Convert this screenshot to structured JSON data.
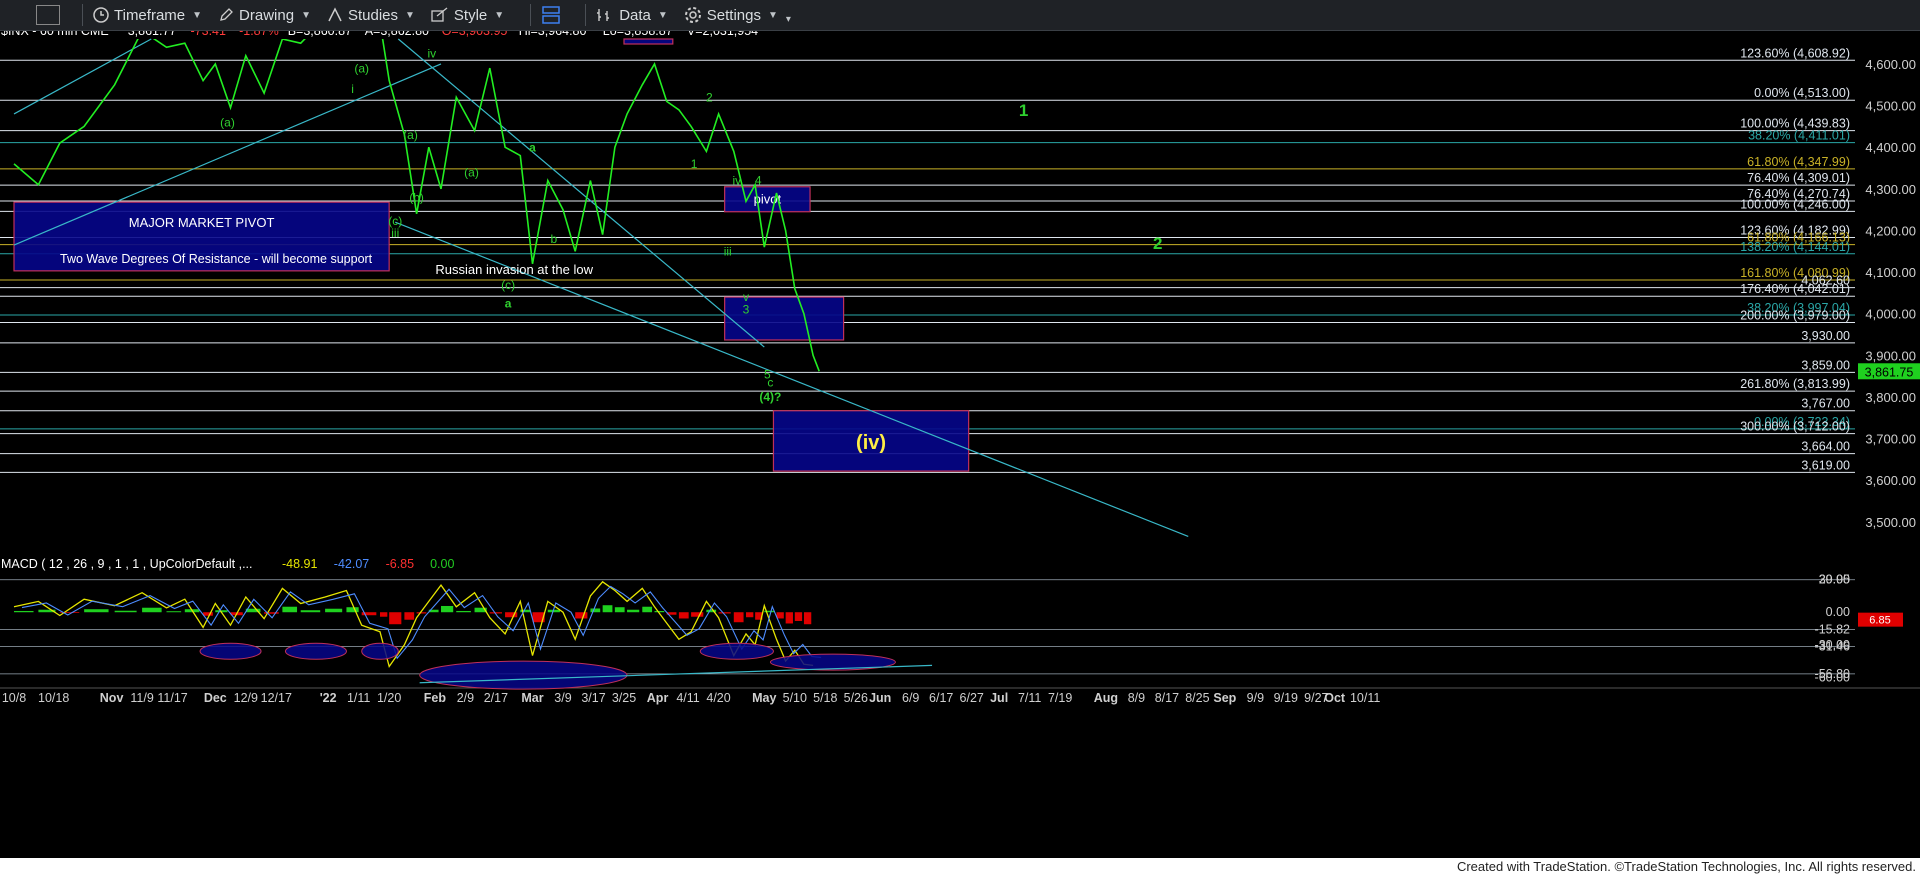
{
  "toolbar": {
    "items": [
      {
        "label": "Timeframe",
        "icon": "clock-icon"
      },
      {
        "label": "Drawing",
        "icon": "pencil-icon"
      },
      {
        "label": "Studies",
        "icon": "studies-icon"
      },
      {
        "label": "Style",
        "icon": "style-icon"
      },
      {
        "label": "Data",
        "icon": "bar-data-icon"
      },
      {
        "label": "Settings",
        "icon": "gear-icon"
      }
    ]
  },
  "footer": {
    "text": "Created with TradeStation. ©TradeStation Technologies, Inc. All rights reserved."
  },
  "chart_data": {
    "type": "line",
    "header": {
      "symbol": "$INX - 60 min CME",
      "last": "3,861.77",
      "change": "-73.41",
      "change_pct": "-1.87%",
      "bid": "B=3,860.87",
      "ask": "A=3,862.80",
      "open": "O=3,903.95",
      "high": "Hi=3,964.80",
      "low": "Lo=3,858.87",
      "volume": "V=2,031,954"
    },
    "ylim": [
      3430,
      4660
    ],
    "y_ticks": [
      "4,600.00",
      "4,500.00",
      "4,400.00",
      "4,300.00",
      "4,200.00",
      "4,100.00",
      "4,000.00",
      "3,900.00",
      "3,800.00",
      "3,700.00",
      "3,600.00",
      "3,500.00"
    ],
    "y_tick_values": [
      4600,
      4500,
      4400,
      4300,
      4200,
      4100,
      4000,
      3900,
      3800,
      3700,
      3600,
      3500
    ],
    "x_ticks": [
      "10/8",
      "10/18",
      "Nov",
      "11/9",
      "11/17",
      "Dec",
      "12/9",
      "12/17",
      "'22",
      "1/11",
      "1/20",
      "Feb",
      "2/9",
      "2/17",
      "Mar",
      "3/9",
      "3/17",
      "3/25",
      "Apr",
      "4/11",
      "4/20",
      "May",
      "5/10",
      "5/18",
      "5/26",
      "Jun",
      "6/9",
      "6/17",
      "6/27",
      "Jul",
      "7/11",
      "7/19",
      "Aug",
      "8/9",
      "8/17",
      "8/25",
      "Sep",
      "9/9",
      "9/19",
      "9/27",
      "Oct",
      "10/11"
    ],
    "x_tick_index": [
      0,
      1.3,
      3.2,
      4.2,
      5.2,
      6.6,
      7.6,
      8.6,
      10.3,
      11.3,
      12.3,
      13.8,
      14.8,
      15.8,
      17,
      18,
      19,
      20,
      21.1,
      22.1,
      23.1,
      24.6,
      25.6,
      26.6,
      27.6,
      28.4,
      29.4,
      30.4,
      31.4,
      32.3,
      33.3,
      34.3,
      35.8,
      36.8,
      37.8,
      38.8,
      39.7,
      40.7,
      41.7,
      42.7,
      43.3,
      44.3
    ],
    "last_price": "3,861.75",
    "last_value": 3861.75,
    "price_path": [
      [
        0,
        4360
      ],
      [
        0.8,
        4310
      ],
      [
        1.5,
        4410
      ],
      [
        2.3,
        4450
      ],
      [
        3.3,
        4550
      ],
      [
        4.2,
        4680
      ],
      [
        5,
        4640
      ],
      [
        5.6,
        4650
      ],
      [
        6.2,
        4560
      ],
      [
        6.6,
        4600
      ],
      [
        7.1,
        4495
      ],
      [
        7.6,
        4620
      ],
      [
        8.2,
        4530
      ],
      [
        8.8,
        4660
      ],
      [
        9.4,
        4650
      ],
      [
        10.2,
        4710
      ],
      [
        10.9,
        4800
      ],
      [
        11.4,
        4700
      ],
      [
        12,
        4700
      ],
      [
        12.3,
        4560
      ],
      [
        12.8,
        4430
      ],
      [
        13.2,
        4240
      ],
      [
        13.6,
        4400
      ],
      [
        14,
        4300
      ],
      [
        14.5,
        4520
      ],
      [
        15.1,
        4440
      ],
      [
        15.6,
        4590
      ],
      [
        16.1,
        4400
      ],
      [
        16.6,
        4380
      ],
      [
        17,
        4120
      ],
      [
        17.5,
        4320
      ],
      [
        18,
        4250
      ],
      [
        18.4,
        4150
      ],
      [
        18.9,
        4320
      ],
      [
        19.3,
        4190
      ],
      [
        19.7,
        4400
      ],
      [
        20.1,
        4480
      ],
      [
        20.6,
        4550
      ],
      [
        21,
        4600
      ],
      [
        21.4,
        4510
      ],
      [
        21.8,
        4490
      ],
      [
        22.2,
        4450
      ],
      [
        22.7,
        4390
      ],
      [
        23.1,
        4480
      ],
      [
        23.6,
        4390
      ],
      [
        24,
        4270
      ],
      [
        24.3,
        4310
      ],
      [
        24.6,
        4160
      ],
      [
        25,
        4290
      ],
      [
        25.3,
        4200
      ],
      [
        25.6,
        4060
      ],
      [
        25.9,
        4000
      ],
      [
        26.2,
        3900
      ],
      [
        26.4,
        3862
      ]
    ],
    "price_series_color": "#22ee22",
    "levels": [
      {
        "label": "123.60% (4,608.92)",
        "value": 4608.92,
        "color": "#dfe6ee"
      },
      {
        "label": "0.00% (4,513.00)",
        "value": 4513.0,
        "color": "#dfe6ee"
      },
      {
        "label": "100.00% (4,439.83)",
        "value": 4439.83,
        "color": "#dfe6ee"
      },
      {
        "label": "38.20% (4,411.01)",
        "value": 4411.01,
        "color": "#2aa7a7"
      },
      {
        "label": "61.80% (4,347.99)",
        "value": 4347.99,
        "color": "#c9b227"
      },
      {
        "label": "76.40% (4,309.01)",
        "value": 4309.01,
        "color": "#dfe6ee"
      },
      {
        "label": "76.40% (4,270.74)",
        "value": 4270.74,
        "color": "#dfe6ee"
      },
      {
        "label": "100.00% (4,246.00)",
        "value": 4246.0,
        "color": "#dfe6ee"
      },
      {
        "label": "123.60% (4,182.99)",
        "value": 4182.99,
        "color": "#dfe6ee"
      },
      {
        "label": "61.80% (4,166.13)",
        "value": 4166.13,
        "color": "#c9b227"
      },
      {
        "label": "138.20% (4,144.01)",
        "value": 4144.01,
        "color": "#2aa7a7"
      },
      {
        "label": "161.80% (4,080.99)",
        "value": 4080.99,
        "color": "#c9b227"
      },
      {
        "label": "4,062.60",
        "value": 4062.6,
        "color": "#dfe6ee"
      },
      {
        "label": "176.40% (4,042.01)",
        "value": 4042.01,
        "color": "#dfe6ee"
      },
      {
        "label": "38.20% (3,997.04)",
        "value": 3997.04,
        "color": "#2aa7a7"
      },
      {
        "label": "200.00% (3,979.00)",
        "value": 3979.0,
        "color": "#dfe6ee"
      },
      {
        "label": "3,930.00",
        "value": 3930.0,
        "color": "#dfe6ee"
      },
      {
        "label": "3,859.00",
        "value": 3859.0,
        "color": "#dfe6ee"
      },
      {
        "label": "261.80% (3,813.99)",
        "value": 3813.99,
        "color": "#dfe6ee"
      },
      {
        "label": "3,767.00",
        "value": 3767.0,
        "color": "#dfe6ee"
      },
      {
        "label": "0.00% (3,723.34)",
        "value": 3723.34,
        "color": "#2aa7a7"
      },
      {
        "label": "300.00% (3,712.00)",
        "value": 3712.0,
        "color": "#dfe6ee"
      },
      {
        "label": "3,664.00",
        "value": 3664.0,
        "color": "#dfe6ee"
      },
      {
        "label": "3,619.00",
        "value": 3619.0,
        "color": "#dfe6ee"
      }
    ],
    "zones": [
      {
        "label": "MAJOR MARKET PIVOT",
        "label2": "Two Wave Degrees Of Resistance - will become support",
        "x0": 0,
        "x1": 12.3,
        "y0": 4268,
        "y1": 4103
      },
      {
        "label": "pivot",
        "x0": 23.3,
        "x1": 26.1,
        "y0": 4305,
        "y1": 4245
      },
      {
        "label": "",
        "x0": 23.3,
        "x1": 27.2,
        "y0": 4040,
        "y1": 3937
      },
      {
        "label": "(iv)",
        "x0": 24.9,
        "x1": 31.3,
        "y0": 3767,
        "y1": 3622
      },
      {
        "label": "",
        "x0": 20,
        "x1": 21.6,
        "y0": 4660,
        "y1": 4648
      }
    ],
    "trendlines": [
      {
        "x0": 0,
        "y0": 4165,
        "x1": 14,
        "y1": 4600,
        "color": "#39b8c8"
      },
      {
        "x0": 0,
        "y0": 4480,
        "x1": 4.5,
        "y1": 4660,
        "color": "#39b8c8"
      },
      {
        "x0": 12.5,
        "y0": 4220,
        "x1": 38.5,
        "y1": 3465,
        "color": "#39b8c8"
      },
      {
        "x0": 12.6,
        "y0": 4660,
        "x1": 24.6,
        "y1": 3920,
        "color": "#39b8c8"
      }
    ],
    "annotations": [
      {
        "text": "(a)",
        "x": 7,
        "y": 4450,
        "color": "#2fd02f"
      },
      {
        "text": "iv",
        "x": 13.7,
        "y": 4615,
        "color": "#2fd02f"
      },
      {
        "text": "(a)",
        "x": 11.4,
        "y": 4580,
        "color": "#2fd02f"
      },
      {
        "text": "i",
        "x": 11.1,
        "y": 4530,
        "color": "#2fd02f"
      },
      {
        "text": "iii",
        "x": 12.5,
        "y": 4184,
        "color": "#2fd02f"
      },
      {
        "text": "(c)",
        "x": 12.5,
        "y": 4213,
        "color": "#2fd02f"
      },
      {
        "text": "(a)",
        "x": 13,
        "y": 4420,
        "color": "#2fd02f"
      },
      {
        "text": "(b)",
        "x": 13.2,
        "y": 4270,
        "color": "#2fd02f"
      },
      {
        "text": "(a)",
        "x": 15,
        "y": 4330,
        "color": "#2fd02f"
      },
      {
        "text": "a",
        "x": 17,
        "y": 4390,
        "color": "#2fd02f"
      },
      {
        "text": "b",
        "x": 17.7,
        "y": 4170,
        "color": "#2fd02f"
      },
      {
        "text": "(c)",
        "x": 16.2,
        "y": 4060,
        "color": "#2fd02f"
      },
      {
        "text": "a",
        "x": 16.2,
        "y": 4015,
        "color": "#2fd02f"
      },
      {
        "text": "2",
        "x": 22.8,
        "y": 4510,
        "color": "#2fd02f"
      },
      {
        "text": "1",
        "x": 22.3,
        "y": 4350,
        "color": "#2fd02f"
      },
      {
        "text": "iv",
        "x": 23.7,
        "y": 4310,
        "color": "#2fd02f"
      },
      {
        "text": "4",
        "x": 24.4,
        "y": 4310,
        "color": "#2fd02f"
      },
      {
        "text": "iii",
        "x": 23.4,
        "y": 4140,
        "color": "#2fd02f"
      },
      {
        "text": "v",
        "x": 24,
        "y": 4030,
        "color": "#2fd02f"
      },
      {
        "text": "3",
        "x": 24,
        "y": 4000,
        "color": "#2fd02f"
      },
      {
        "text": "5",
        "x": 24.7,
        "y": 3845,
        "color": "#2fd02f"
      },
      {
        "text": "c",
        "x": 24.8,
        "y": 3825,
        "color": "#2fd02f"
      },
      {
        "text": "(4)?",
        "x": 24.8,
        "y": 3790,
        "color": "#2fd02f"
      },
      {
        "text": "1",
        "x": 33.1,
        "y": 4475,
        "color": "#2fd02f"
      },
      {
        "text": "2",
        "x": 37.5,
        "y": 4155,
        "color": "#2fd02f"
      },
      {
        "text": "Russian invasion at the low",
        "x": 16.4,
        "y": 4095,
        "color": "#ffffff"
      }
    ],
    "macd": {
      "label": "MACD ( 12 , 26 , 9 , 1 , 1 , UpColorDefault ,...",
      "values": [
        "-48.91",
        "-42.07",
        "-6.85",
        "0.00"
      ],
      "value_colors": [
        "#e6e600",
        "#4d8cff",
        "#ff3030",
        "#22cc22"
      ],
      "ylim": [
        -68,
        38
      ],
      "y_ticks": [
        "29.95",
        "30.00",
        "0.00",
        "-15.82",
        "-31.46",
        "-30.00",
        "-56.80",
        "-60.00"
      ],
      "y_tick_values": [
        29.95,
        30,
        0,
        -15.82,
        -31.46,
        -30,
        -56.8,
        -60
      ],
      "last_hist": "6.85",
      "hline_values": [
        29.95,
        -15.82,
        -31.46,
        -56.8
      ],
      "macd_path": [
        [
          0,
          5
        ],
        [
          0.8,
          10
        ],
        [
          1.5,
          -3
        ],
        [
          2.3,
          12
        ],
        [
          3.3,
          6
        ],
        [
          4.2,
          18
        ],
        [
          5,
          4
        ],
        [
          5.6,
          12
        ],
        [
          6.2,
          -14
        ],
        [
          6.6,
          8
        ],
        [
          7.1,
          -12
        ],
        [
          7.6,
          14
        ],
        [
          8.2,
          -6
        ],
        [
          8.8,
          22
        ],
        [
          9.4,
          8
        ],
        [
          10.2,
          14
        ],
        [
          10.9,
          20
        ],
        [
          11.4,
          -12
        ],
        [
          12,
          -18
        ],
        [
          12.3,
          -50
        ],
        [
          12.8,
          -30
        ],
        [
          13.2,
          -5
        ],
        [
          13.6,
          10
        ],
        [
          14,
          25
        ],
        [
          14.5,
          5
        ],
        [
          15.1,
          18
        ],
        [
          15.6,
          -5
        ],
        [
          16.1,
          -20
        ],
        [
          16.6,
          10
        ],
        [
          17,
          -40
        ],
        [
          17.5,
          10
        ],
        [
          18,
          0
        ],
        [
          18.4,
          -25
        ],
        [
          18.9,
          15
        ],
        [
          19.3,
          28
        ],
        [
          19.7,
          20
        ],
        [
          20.1,
          10
        ],
        [
          20.6,
          22
        ],
        [
          21,
          5
        ],
        [
          21.4,
          -10
        ],
        [
          21.8,
          -25
        ],
        [
          22.2,
          -18
        ],
        [
          22.7,
          10
        ],
        [
          23.1,
          -5
        ],
        [
          23.6,
          -40
        ],
        [
          24,
          -20
        ],
        [
          24.3,
          -30
        ],
        [
          24.6,
          6
        ],
        [
          25,
          -25
        ],
        [
          25.3,
          -45
        ],
        [
          25.6,
          -35
        ],
        [
          25.9,
          -48
        ],
        [
          26.2,
          -49
        ]
      ],
      "ellipses": [
        {
          "x0": 6.1,
          "x1": 8.1,
          "yc": -36
        },
        {
          "x0": 8.9,
          "x1": 10.9,
          "yc": -36
        },
        {
          "x0": 11.4,
          "x1": 12.6,
          "yc": -36
        },
        {
          "x0": 13.3,
          "x1": 20.1,
          "yc": -58
        },
        {
          "x0": 22.5,
          "x1": 24.9,
          "yc": -36
        },
        {
          "x0": 24.8,
          "x1": 28.9,
          "yc": -46
        }
      ],
      "trendline": {
        "x0": 13.3,
        "y0": -65,
        "x1": 30.1,
        "y1": -49
      }
    }
  }
}
